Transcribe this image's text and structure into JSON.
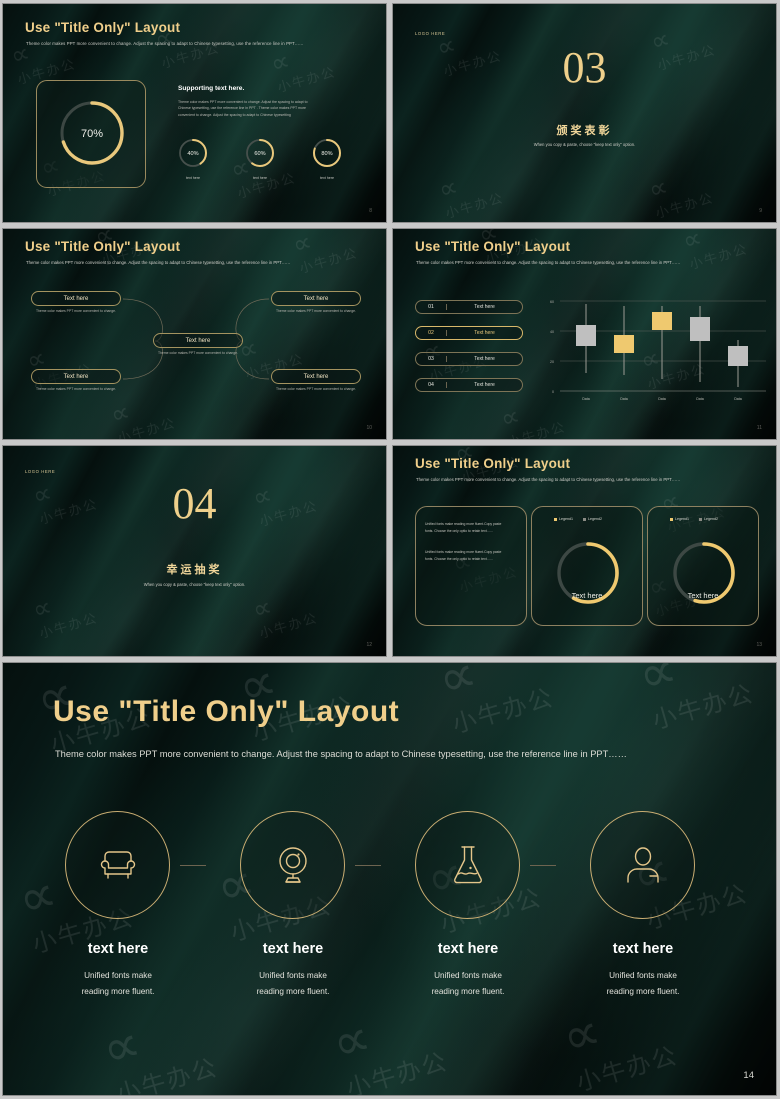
{
  "theme": {
    "gold": "#e9c87c",
    "gold_light": "#f0cf8b",
    "grey_bar": "#b9b9b4",
    "background": "#060a09"
  },
  "watermark": {
    "mark": "∝",
    "text": "小牛办公"
  },
  "slides": [
    {
      "id": "slide-08",
      "title": "Use \"Title Only\" Layout",
      "subtitle": "Theme color makes PPT more convenient to change. Adjust the spacing to adapt to Chinese typesetting, use the reference line in PPT……",
      "main_gauge": {
        "value": "70%",
        "percent": 70
      },
      "supporting_heading": "Supporting text here.",
      "supporting_body": "Theme color makes PPT more convenient to change. Adjust the spacing to adapt to Chinese typesetting, use the reference line in PPT . Theme color makes PPT more convenient to change. Adjust the spacing to adapt to Chinese typesetting",
      "mini_gauges": [
        {
          "value": "40%",
          "percent": 40,
          "label": "text here"
        },
        {
          "value": "60%",
          "percent": 60,
          "label": "text here"
        },
        {
          "value": "80%",
          "percent": 80,
          "label": "text here"
        }
      ],
      "page": "8"
    },
    {
      "id": "slide-09",
      "logo": "LOGO HERE",
      "section_number": "03",
      "section_title_cn": "颁奖表彰",
      "section_note": "When you copy & paste, choose \"keep text only\" option.",
      "page": "9"
    },
    {
      "id": "slide-10",
      "title": "Use \"Title Only\" Layout",
      "subtitle": "Theme color makes PPT more convenient to change. Adjust the spacing to adapt to Chinese typesetting, use the reference line in PPT……",
      "nodes": [
        {
          "label": "Text here",
          "caption": "Theme color makes PPT more convenient to change."
        },
        {
          "label": "Text here",
          "caption": "Theme color makes PPT more convenient to change."
        },
        {
          "label": "Text here",
          "caption": "Theme color makes PPT more convenient to change."
        },
        {
          "label": "Text here",
          "caption": "Theme color makes PPT more convenient to change."
        },
        {
          "label": "Text here",
          "caption": "Theme color makes PPT more convenient to change."
        }
      ],
      "page": "10"
    },
    {
      "id": "slide-11",
      "title": "Use \"Title Only\" Layout",
      "subtitle": "Theme color makes PPT more convenient to change. Adjust the spacing to adapt to Chinese typesetting, use the reference line in PPT……",
      "list": [
        {
          "num": "01",
          "label": "Text here",
          "active": false
        },
        {
          "num": "02",
          "label": "Text here",
          "active": true
        },
        {
          "num": "03",
          "label": "Text here",
          "active": false
        },
        {
          "num": "04",
          "label": "Text here",
          "active": false
        }
      ],
      "page": "11"
    },
    {
      "id": "slide-12",
      "logo": "LOGO HERE",
      "section_number": "04",
      "section_title_cn": "幸运抽奖",
      "section_note": "When you copy & paste, choose \"keep text only\" option.",
      "page": "12"
    },
    {
      "id": "slide-13",
      "title": "Use \"Title Only\" Layout",
      "subtitle": "Theme color makes PPT more convenient to change. Adjust the spacing to adapt to Chinese typesetting, use the reference line in PPT……",
      "text_card": [
        "Unified fonts make reading more fluent.Copy paste fonts. Choose the only optio to retain text……",
        "Unified fonts make reading more fluent.Copy paste fonts. Choose the only optio to retain text……"
      ],
      "donuts": [
        {
          "legend1": "Legend1",
          "legend2": "Legend2",
          "center": "Text here",
          "percent": 58
        },
        {
          "legend1": "Legend1",
          "legend2": "Legend2",
          "center": "Text here",
          "percent": 55
        }
      ],
      "page": "13"
    },
    {
      "id": "slide-14",
      "title": "Use \"Title Only\" Layout",
      "subtitle": "Theme color makes PPT more convenient to change. Adjust the spacing to adapt to Chinese typesetting, use the reference line in PPT……",
      "columns": [
        {
          "icon": "armchair-icon",
          "heading": "text here",
          "body": "Unified fonts make\nreading more fluent."
        },
        {
          "icon": "webcam-icon",
          "heading": "text here",
          "body": "Unified fonts make\nreading more fluent."
        },
        {
          "icon": "flask-icon",
          "heading": "text here",
          "body": "Unified fonts make\nreading more fluent."
        },
        {
          "icon": "person-icon",
          "heading": "text here",
          "body": "Unified fonts make\nreading more fluent."
        }
      ],
      "page": "14"
    }
  ],
  "chart_data": {
    "type": "bar",
    "title": "",
    "xlabel": "",
    "ylabel": "",
    "ylim": [
      0,
      60
    ],
    "yticks": [
      0,
      20,
      40,
      60
    ],
    "grid": true,
    "categories": [
      "Data",
      "Data",
      "Data",
      "Data",
      "Data"
    ],
    "series": [
      {
        "name": "box-low",
        "values": [
          30,
          25,
          41,
          28,
          17
        ]
      },
      {
        "name": "box-high",
        "values": [
          44,
          37,
          53,
          49,
          32
        ]
      },
      {
        "name": "whisker-low",
        "values": [
          12,
          11,
          8,
          6,
          2
        ]
      },
      {
        "name": "whisker-high",
        "values": [
          58,
          57,
          57,
          57,
          35
        ]
      }
    ],
    "colors": [
      "#bfbfbf",
      "#efc96f",
      "#efc96f",
      "#bfbfbf",
      "#bfbfbf"
    ]
  }
}
